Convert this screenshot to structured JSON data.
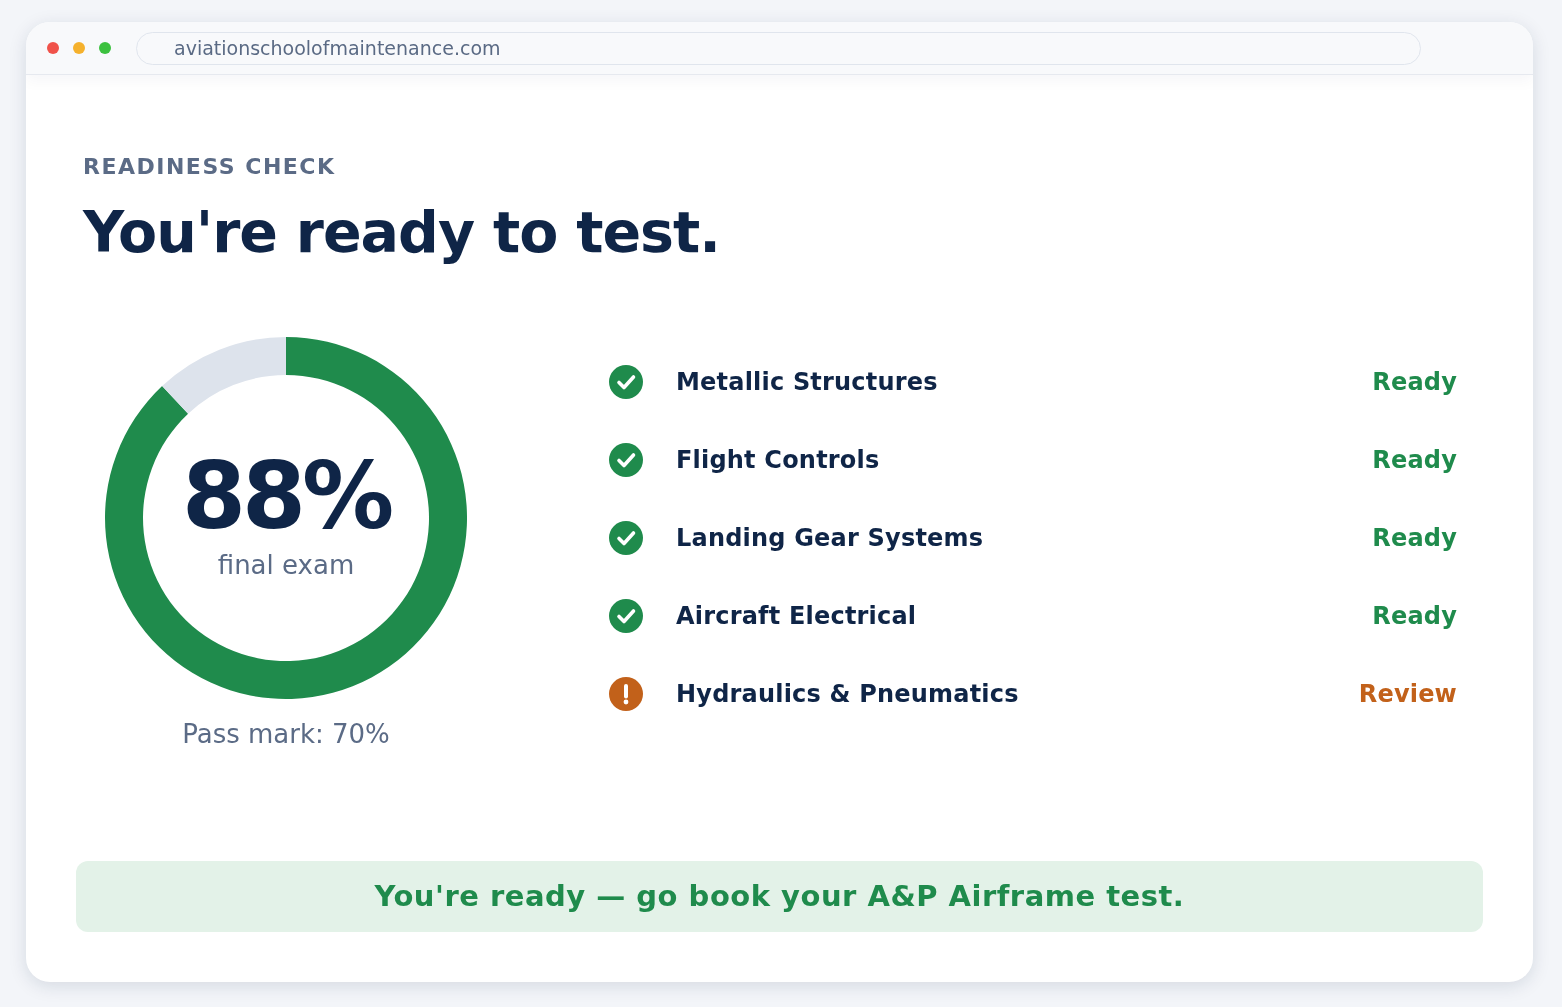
{
  "browser": {
    "url": "aviationschoolofmaintenance.com"
  },
  "header": {
    "eyebrow": "READINESS CHECK",
    "title": "You're ready to test."
  },
  "score": {
    "value": "88%",
    "caption": "final exam",
    "chart_data": {
      "type": "donut",
      "values": [
        88,
        12
      ]
    },
    "pass_mark": "Pass mark: 70%"
  },
  "topics": [
    {
      "label": "Metallic Structures",
      "status": "Ready",
      "kind": "ready"
    },
    {
      "label": "Flight Controls",
      "status": "Ready",
      "kind": "ready"
    },
    {
      "label": "Landing Gear Systems",
      "status": "Ready",
      "kind": "ready"
    },
    {
      "label": "Aircraft Electrical",
      "status": "Ready",
      "kind": "ready"
    },
    {
      "label": "Hydraulics & Pneumatics",
      "status": "Review",
      "kind": "review"
    }
  ],
  "banner": {
    "text": "You're ready — go book your A&P Airframe test."
  }
}
